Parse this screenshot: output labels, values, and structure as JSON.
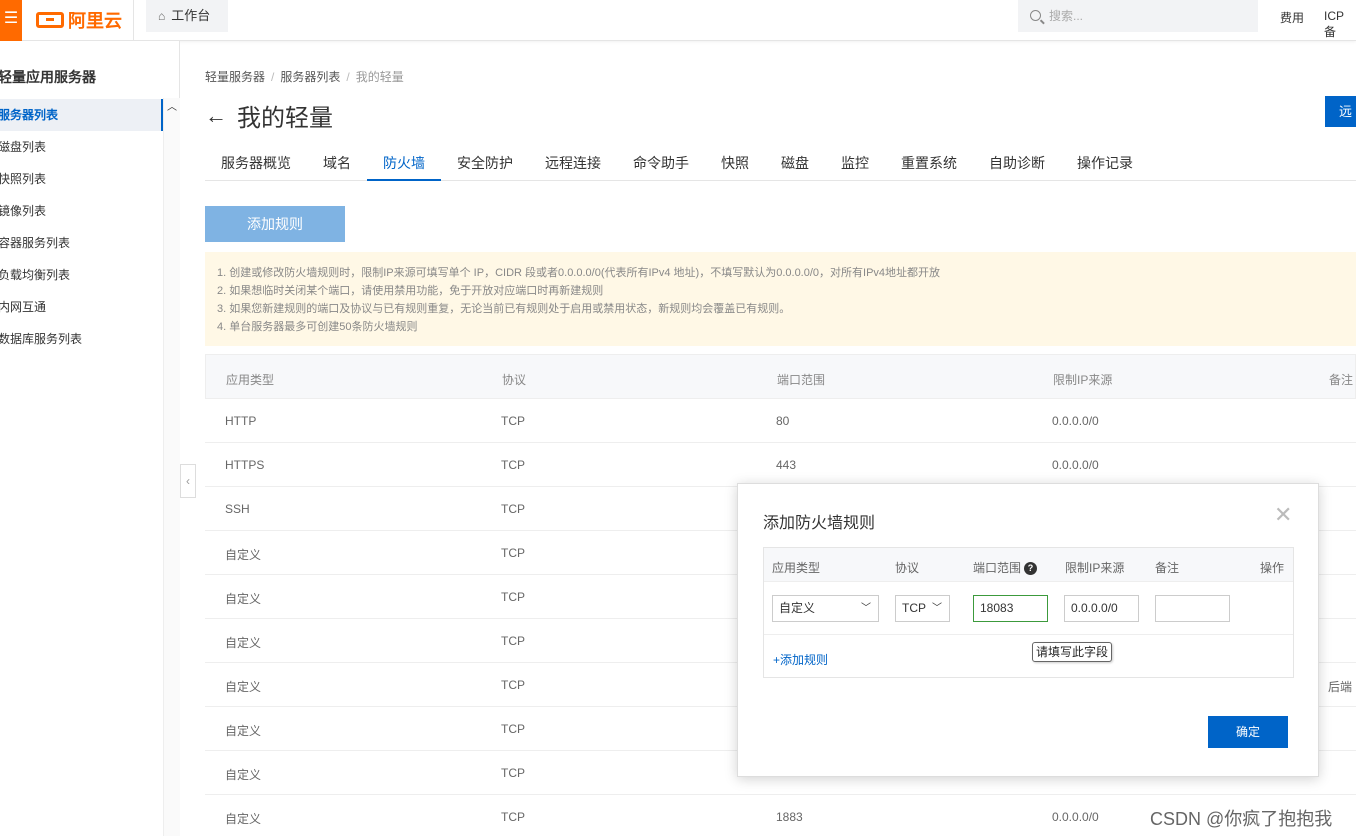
{
  "topbar": {
    "menu_icon": "menu-icon",
    "logo_text": "阿里云",
    "workbench_label": "工作台",
    "search_placeholder": "搜索...",
    "links": [
      "费用",
      "ICP 备"
    ]
  },
  "sidebar": {
    "title": "轻量应用服务器",
    "items": [
      {
        "label": "服务器列表",
        "active": true
      },
      {
        "label": "磁盘列表"
      },
      {
        "label": "快照列表"
      },
      {
        "label": "镜像列表"
      },
      {
        "label": "容器服务列表"
      },
      {
        "label": "负载均衡列表"
      },
      {
        "label": "内网互通"
      },
      {
        "label": "数据库服务列表"
      }
    ]
  },
  "breadcrumb": [
    "轻量服务器",
    "服务器列表",
    "我的轻量"
  ],
  "page": {
    "title": "我的轻量",
    "remote_button": "远"
  },
  "tabs": [
    "服务器概览",
    "域名",
    "防火墙",
    "安全防护",
    "远程连接",
    "命令助手",
    "快照",
    "磁盘",
    "监控",
    "重置系统",
    "自助诊断",
    "操作记录"
  ],
  "active_tab": "防火墙",
  "add_rule_button": "添加规则",
  "notice": [
    "1. 创建或修改防火墙规则时，限制IP来源可填写单个 IP，CIDR 段或者0.0.0.0/0(代表所有IPv4 地址)，不填写默认为0.0.0.0/0，对所有IPv4地址都开放",
    "2. 如果想临时关闭某个端口，请使用禁用功能，免于开放对应端口时再新建规则",
    "3. 如果您新建规则的端口及协议与已有规则重复，无论当前已有规则处于启用或禁用状态，新规则均会覆盖已有规则。",
    "4. 单台服务器最多可创建50条防火墙规则"
  ],
  "table": {
    "headers": [
      "应用类型",
      "协议",
      "端口范围",
      "限制IP来源",
      "备注"
    ],
    "rows": [
      [
        "HTTP",
        "TCP",
        "80",
        "0.0.0.0/0",
        ""
      ],
      [
        "HTTPS",
        "TCP",
        "443",
        "0.0.0.0/0",
        ""
      ],
      [
        "SSH",
        "TCP",
        "",
        "",
        ""
      ],
      [
        "自定义",
        "TCP",
        "",
        "",
        ""
      ],
      [
        "自定义",
        "TCP",
        "",
        "",
        ""
      ],
      [
        "自定义",
        "TCP",
        "",
        "",
        ""
      ],
      [
        "自定义",
        "TCP",
        "",
        "",
        "后端"
      ],
      [
        "自定义",
        "TCP",
        "",
        "",
        ""
      ],
      [
        "自定义",
        "TCP",
        "",
        "",
        ""
      ],
      [
        "自定义",
        "TCP",
        "1883",
        "0.0.0.0/0",
        ""
      ]
    ]
  },
  "modal": {
    "title": "添加防火墙规则",
    "close_icon": "close-icon",
    "headers": [
      "应用类型",
      "协议",
      "端口范围",
      "限制IP来源",
      "备注",
      "操作"
    ],
    "help_icon": "?",
    "row": {
      "app_type": "自定义",
      "protocol": "TCP",
      "port": "18083",
      "ip_source": "0.0.0.0/0",
      "remark": ""
    },
    "add_rule_link": "+添加规则",
    "tooltip": "请填写此字段",
    "confirm_button": "确定"
  },
  "watermark": "CSDN @你疯了抱抱我"
}
